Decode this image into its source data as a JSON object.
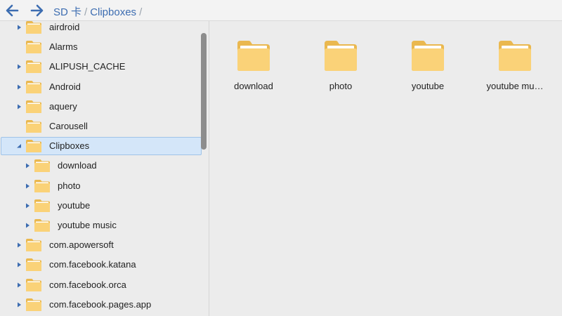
{
  "colors": {
    "folder_fill": "#fad278",
    "folder_back": "#eab84f",
    "folder_paper": "#ffffff",
    "accent": "#3d6db1",
    "selection": "#d4e6f9"
  },
  "toolbar": {
    "back_icon": "arrow-left-icon",
    "forward_icon": "arrow-right-icon",
    "breadcrumb": [
      "SD 卡",
      "Clipboxes"
    ],
    "separator": "/"
  },
  "sidebar": {
    "items": [
      {
        "label": "airdroid",
        "level": 0,
        "expander": "collapsed",
        "selected": false
      },
      {
        "label": "Alarms",
        "level": 0,
        "expander": "none",
        "selected": false
      },
      {
        "label": "ALIPUSH_CACHE",
        "level": 0,
        "expander": "collapsed",
        "selected": false
      },
      {
        "label": "Android",
        "level": 0,
        "expander": "collapsed",
        "selected": false
      },
      {
        "label": "aquery",
        "level": 0,
        "expander": "collapsed",
        "selected": false
      },
      {
        "label": "Carousell",
        "level": 0,
        "expander": "none",
        "selected": false
      },
      {
        "label": "Clipboxes",
        "level": 0,
        "expander": "expanded",
        "selected": true
      },
      {
        "label": "download",
        "level": 1,
        "expander": "collapsed",
        "selected": false
      },
      {
        "label": "photo",
        "level": 1,
        "expander": "collapsed",
        "selected": false
      },
      {
        "label": "youtube",
        "level": 1,
        "expander": "collapsed",
        "selected": false
      },
      {
        "label": "youtube music",
        "level": 1,
        "expander": "collapsed",
        "selected": false
      },
      {
        "label": "com.apowersoft",
        "level": 0,
        "expander": "collapsed",
        "selected": false
      },
      {
        "label": "com.facebook.katana",
        "level": 0,
        "expander": "collapsed",
        "selected": false
      },
      {
        "label": "com.facebook.orca",
        "level": 0,
        "expander": "collapsed",
        "selected": false
      },
      {
        "label": "com.facebook.pages.app",
        "level": 0,
        "expander": "collapsed",
        "selected": false
      }
    ]
  },
  "main": {
    "folders": [
      {
        "label": "download"
      },
      {
        "label": "photo"
      },
      {
        "label": "youtube"
      },
      {
        "label": "youtube mu…"
      }
    ]
  }
}
